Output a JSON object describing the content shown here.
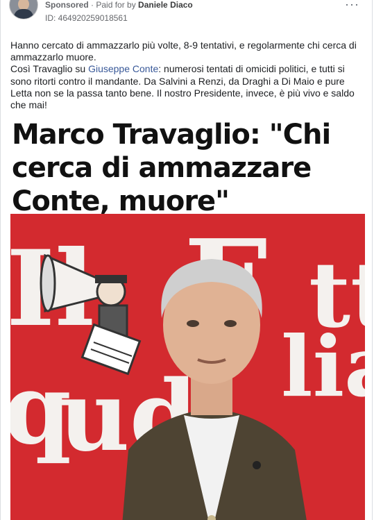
{
  "post": {
    "sponsored_label": "Sponsored",
    "separator": " · ",
    "paid_for_label": "Paid for by ",
    "advertiser": "Daniele Diaco",
    "ad_id": "ID: 464920259018561",
    "more_label": "···"
  },
  "body_text": {
    "line1": "Hanno cercato di ammazzarlo più volte, 8-9 tentativi, e regolarmente chi cerca di ammazzarlo muore.",
    "p2_before_link": "Così Travaglio su ",
    "p2_link": "Giuseppe Conte",
    "p2_after_link": ": numerosi tentati di omicidi politici, e tutti si sono ritorti contro il mandante. Da Salvini a Renzi, da Draghi a Di Maio e pure Letta non se la passa tanto bene. Il nostro Presidente, invece, è più vivo e saldo che mai!"
  },
  "image": {
    "headline_line1": "Marco Travaglio: \"Chi",
    "headline_line2": "cerca di ammazzare",
    "headline_line3": "Conte, muore\""
  },
  "colors": {
    "link": "#385898",
    "photo_background": "#d32a2f",
    "meta_text": "#65676b"
  }
}
